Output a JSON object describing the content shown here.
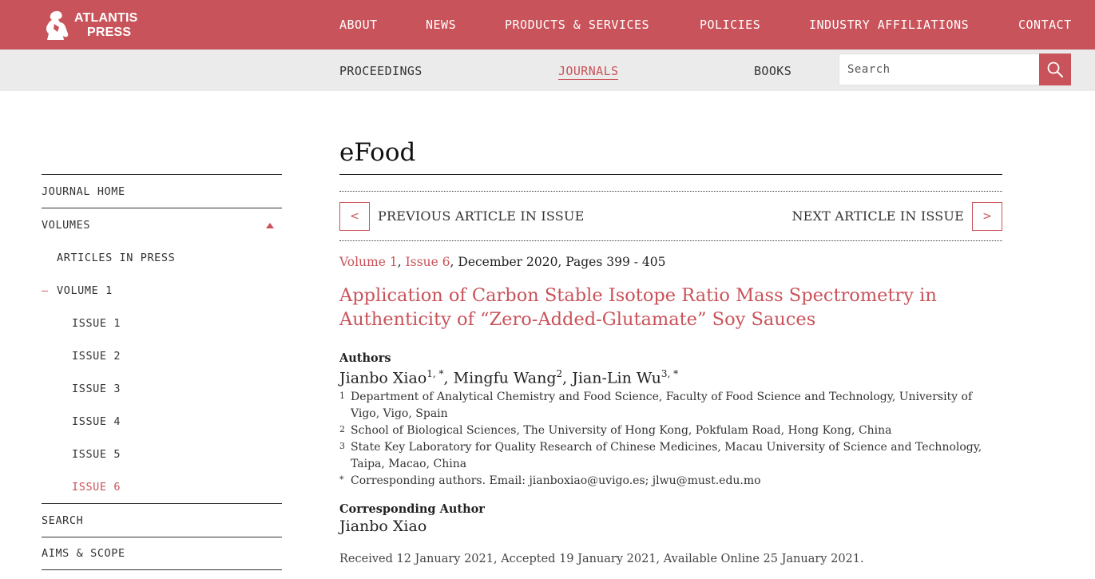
{
  "header": {
    "logo_line1": "ATLANTIS",
    "logo_line2": "PRESS",
    "nav": [
      "ABOUT",
      "NEWS",
      "PRODUCTS & SERVICES",
      "POLICIES",
      "INDUSTRY AFFILIATIONS",
      "CONTACT"
    ]
  },
  "subnav": {
    "items": [
      "PROCEEDINGS",
      "JOURNALS",
      "BOOKS"
    ],
    "active": "JOURNALS",
    "search_placeholder": "Search"
  },
  "sidebar": {
    "journal_home": "JOURNAL HOME",
    "volumes": "VOLUMES",
    "articles_in_press": "ARTICLES IN PRESS",
    "volume_dash": "–",
    "volume": "VOLUME 1",
    "issues": [
      "ISSUE 1",
      "ISSUE 2",
      "ISSUE 3",
      "ISSUE 4",
      "ISSUE 5",
      "ISSUE 6"
    ],
    "active_issue": "ISSUE 6",
    "search": "SEARCH",
    "aims_scope": "AIMS & SCOPE"
  },
  "main": {
    "journal_title": "eFood",
    "prev_label": "PREVIOUS ARTICLE IN ISSUE",
    "next_label": "NEXT ARTICLE IN ISSUE",
    "prev_glyph": "<",
    "next_glyph": ">",
    "volume_link": "Volume 1",
    "volume_sep": ", ",
    "issue_link": "Issue 6",
    "volume_rest": ", December 2020, Pages 399 - 405",
    "article_title": "Application of Carbon Stable Isotope Ratio Mass Spectrometry in Authenticity of “Zero-Added-Glutamate” Soy Sauces",
    "authors_label": "Authors",
    "authors": [
      {
        "name": "Jianbo Xiao",
        "sup": "1, *",
        "sep": ", "
      },
      {
        "name": "Mingfu Wang",
        "sup": "2",
        "sep": ", "
      },
      {
        "name": "Jian-Lin Wu",
        "sup": "3, *",
        "sep": ""
      }
    ],
    "affiliations": [
      {
        "n": "1",
        "text": "Department of Analytical Chemistry and Food Science, Faculty of Food Science and Technology, University of Vigo, Vigo, Spain"
      },
      {
        "n": "2",
        "text": "School of Biological Sciences, The University of Hong Kong, Pokfulam Road, Hong Kong, China"
      },
      {
        "n": "3",
        "text": "State Key Laboratory for Quality Research of Chinese Medicines, Macau University of Science and Technology, Taipa, Macao, China"
      },
      {
        "n": "*",
        "text": "Corresponding authors. Email: jianboxiao@uvigo.es; jlwu@must.edu.mo"
      }
    ],
    "corresponding_label": "Corresponding Author",
    "corresponding_name": "Jianbo Xiao",
    "dates": "Received 12 January 2021, Accepted 19 January 2021, Available Online 25 January 2021."
  },
  "colors": {
    "brand": "#c9535a",
    "subbar": "#ebebeb"
  }
}
